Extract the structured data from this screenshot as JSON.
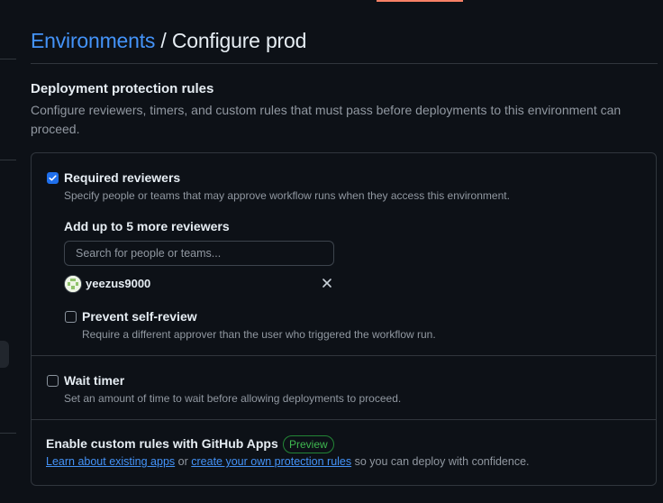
{
  "header": {
    "breadcrumb_link": "Environments",
    "separator": "/",
    "title": "Configure prod"
  },
  "section": {
    "title": "Deployment protection rules",
    "description": "Configure reviewers, timers, and custom rules that must pass before deployments to this environment can proceed."
  },
  "required_reviewers": {
    "checked": true,
    "label": "Required reviewers",
    "description": "Specify people or teams that may approve workflow runs when they access this environment.",
    "add_label": "Add up to 5 more reviewers",
    "search_placeholder": "Search for people or teams...",
    "reviewers": [
      {
        "name": "yeezus9000"
      }
    ],
    "prevent_self_review": {
      "checked": false,
      "label": "Prevent self-review",
      "description": "Require a different approver than the user who triggered the workflow run."
    }
  },
  "wait_timer": {
    "checked": false,
    "label": "Wait timer",
    "description": "Set an amount of time to wait before allowing deployments to proceed."
  },
  "custom_rules": {
    "title": "Enable custom rules with GitHub Apps",
    "badge": "Preview",
    "link1": "Learn about existing apps",
    "text_or": "or",
    "link2": "create your own protection rules",
    "text_tail": "so you can deploy with confidence."
  },
  "colors": {
    "background": "#0d1117",
    "link": "#4493f8",
    "checkbox_checked": "#1f6feb",
    "badge_green": "#3fb950",
    "border": "#30363d",
    "muted_text": "#9198a1"
  }
}
